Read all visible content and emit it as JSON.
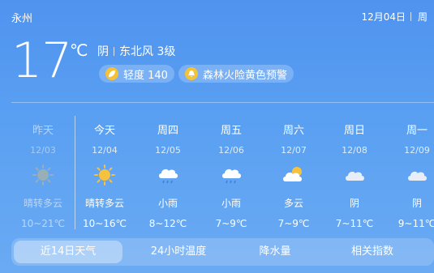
{
  "header": {
    "city": "永州",
    "date": "12月04日",
    "weekday_partial": "周"
  },
  "current": {
    "temperature": "17",
    "unit": "℃",
    "condition": "阴",
    "wind": "东北风 3级",
    "aqi": "轻度 140",
    "alert": "森林火险黄色预警"
  },
  "days": [
    {
      "name": "昨天",
      "date": "12/03",
      "condition": "晴转多云",
      "range": "10~21℃",
      "icon": "sun-icon",
      "past": true
    },
    {
      "name": "今天",
      "date": "12/04",
      "condition": "晴转多云",
      "range": "10~16℃",
      "icon": "sun-icon",
      "past": false
    },
    {
      "name": "周四",
      "date": "12/05",
      "condition": "小雨",
      "range": "8~12℃",
      "icon": "rain-cloud-icon",
      "past": false
    },
    {
      "name": "周五",
      "date": "12/06",
      "condition": "小雨",
      "range": "7~9℃",
      "icon": "rain-cloud-icon",
      "past": false
    },
    {
      "name": "周六",
      "date": "12/07",
      "condition": "多云",
      "range": "7~9℃",
      "icon": "partly-cloudy-icon",
      "past": false
    },
    {
      "name": "周日",
      "date": "12/08",
      "condition": "阴",
      "range": "7~11℃",
      "icon": "cloud-icon",
      "past": false
    },
    {
      "name": "周一",
      "date": "12/09",
      "condition": "阴",
      "range": "9~11℃",
      "icon": "cloud-icon",
      "past": false
    }
  ],
  "tabs": [
    "近14日天气",
    "24小时温度",
    "降水量",
    "相关指数"
  ],
  "active_tab": "近14日天气",
  "colors": {
    "sun": "#f6c23e",
    "sun_past": "#c9b98a",
    "cloud": "#ffffff",
    "rain": "#3f7fe0"
  }
}
